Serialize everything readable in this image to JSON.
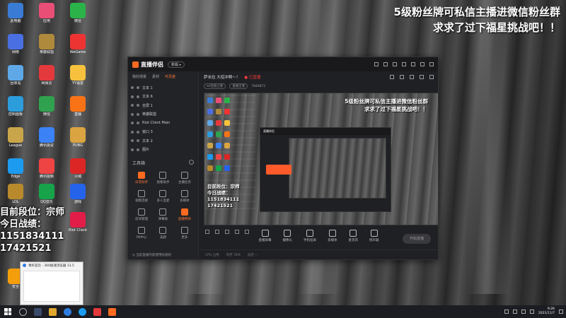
{
  "overlay": {
    "top_right_line1": "5级粉丝牌可私信主播进微信粉丝群",
    "top_right_line2": "求求了过下福星挑战吧！！",
    "left_line1": "目前段位：宗师",
    "left_line2": "今日战绩：",
    "left_line3": "1151834111",
    "left_line4": "17421521"
  },
  "app": {
    "logo_text": "直播伴侣",
    "badge": "新版 ▸",
    "left_tabs": [
      "我的场景",
      "素材",
      "可见度"
    ],
    "scenes": [
      "文本 1",
      "文本 6",
      "全屏 1",
      "英雄联盟",
      "Riot Client Main",
      "窗口 3",
      "文本 2",
      "图片"
    ],
    "tools_title": "工具箱",
    "tools": [
      "抖音助手",
      "观看助手",
      "主播任务",
      "视频连接",
      "多人连麦",
      "多媒体",
      "房间管理",
      "弹幕助",
      "直播特效",
      "PK中心",
      "美颜",
      "更多"
    ],
    "left_footer": "◎ 当前直播内容使用权规则",
    "stream_title": "萨米拉 大招冲啊～！",
    "live_tag": "● 已直播",
    "sub_pill1": "lol连接之家",
    "sub_pill2": "直播王者",
    "sub_count": "7846871",
    "bottom_tools": [
      "直播屏幕",
      "摄像头",
      "手机投屏",
      "多媒体",
      "麦克风",
      "扬声器"
    ],
    "go_live": "开始直播",
    "status": [
      "CPU 占用",
      "内存 78%",
      "延迟 --"
    ]
  },
  "preview": {
    "text_line1": "5级粉丝牌可私信主播进微信粉丝群",
    "text_line2": "求求了过下福星挑战吧！！",
    "left_text1": "目前段位：宗师",
    "left_text2": "今日战绩：",
    "left_text3": "1151834111",
    "left_text4": "17421521",
    "nested_title": "直播伴侣"
  },
  "thumbnail": {
    "title": "青柠首页 · 360极速浏览器 13.5"
  },
  "taskbar": {
    "time": "9:26",
    "date": "2021/11/7"
  },
  "colors": {
    "accent": "#ff6a21",
    "live_red": "#ff3b3b",
    "window_bg": "#1f2024"
  }
}
